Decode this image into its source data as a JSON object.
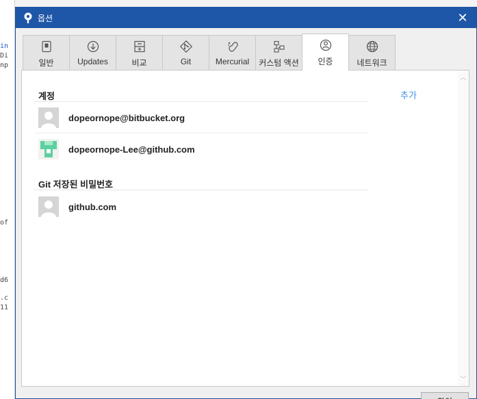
{
  "dialog": {
    "title": "옵션",
    "close_glyph": "✕"
  },
  "tabs": [
    {
      "label": "일반",
      "icon": "general-icon",
      "active": false
    },
    {
      "label": "Updates",
      "icon": "download-icon",
      "active": false
    },
    {
      "label": "비교",
      "icon": "diff-icon",
      "active": false
    },
    {
      "label": "Git",
      "icon": "git-icon",
      "active": false
    },
    {
      "label": "Mercurial",
      "icon": "mercurial-icon",
      "active": false
    },
    {
      "label": "커스텀 액션",
      "icon": "custom-actions-icon",
      "active": false
    },
    {
      "label": "인증",
      "icon": "authentication-icon",
      "active": true
    },
    {
      "label": "네트워크",
      "icon": "globe-icon",
      "active": false
    }
  ],
  "auth": {
    "accounts_header": "계정",
    "add_label": "추가",
    "accounts": [
      {
        "name": "dopeornope@bitbucket.org",
        "avatar": "default-avatar-icon"
      },
      {
        "name": "dopeornope-Lee@github.com",
        "avatar": "identicon-avatar-icon"
      }
    ],
    "saved_passwords_header": "Git 저장된 비밀번호",
    "saved_passwords": [
      {
        "name": "github.com",
        "avatar": "default-avatar-icon"
      }
    ]
  },
  "footer": {
    "ok_label": "확인"
  },
  "colors": {
    "titlebar": "#1f57a8",
    "link": "#3c8fe0",
    "identicon": "#5ecfa0"
  }
}
